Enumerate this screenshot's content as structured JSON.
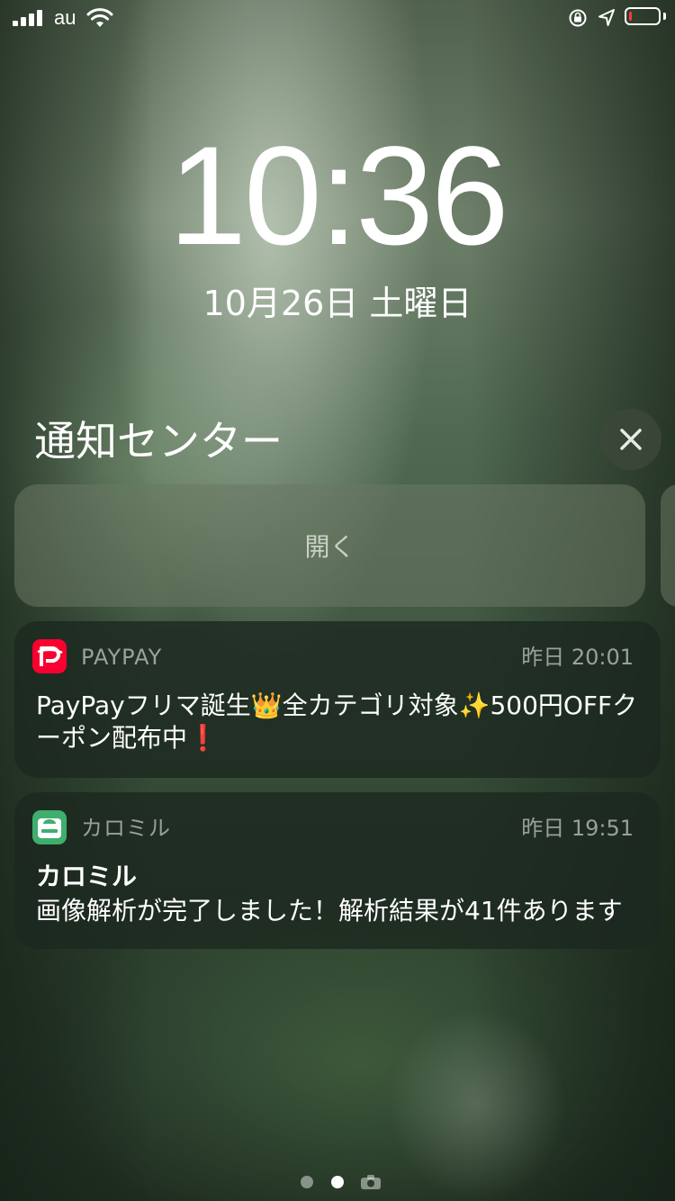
{
  "status_bar": {
    "carrier": "au",
    "battery_level": 0.1,
    "battery_color": "#ff3b30"
  },
  "lock_screen": {
    "time": "10:36",
    "date": "10月26日 土曜日"
  },
  "notification_center": {
    "title": "通知センター",
    "open_label": "開く"
  },
  "notifications": [
    {
      "app_name": "PAYPAY",
      "time": "昨日 20:01",
      "body": "PayPayフリマ誕生👑全カテゴリ対象✨500円OFFクーポン配布中❗",
      "icon": "paypay-icon",
      "icon_color": "#fa0030"
    },
    {
      "app_name": "カロミル",
      "time": "昨日 19:51",
      "title": "カロミル",
      "body": "画像解析が完了しました！解析結果が41件あります",
      "icon": "calomeal-icon",
      "icon_color": "#3fae6e"
    }
  ],
  "page_indicator": {
    "pages": 3,
    "current": 2
  }
}
